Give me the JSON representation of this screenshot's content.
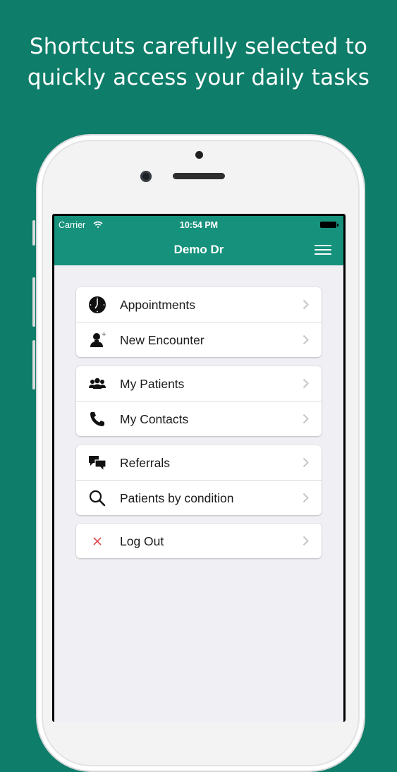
{
  "headline": {
    "line1": "Shortcuts carefully selected to",
    "line2": "quickly access your daily tasks"
  },
  "status_bar": {
    "carrier": "Carrier",
    "time": "10:54 PM"
  },
  "navbar": {
    "title": "Demo Dr",
    "menu_icon": "hamburger-icon"
  },
  "groups": [
    {
      "items": [
        {
          "label": "Appointments",
          "icon": "clock-icon"
        },
        {
          "label": "New Encounter",
          "icon": "person-add-icon"
        }
      ]
    },
    {
      "items": [
        {
          "label": "My Patients",
          "icon": "group-icon"
        },
        {
          "label": "My Contacts",
          "icon": "phone-icon"
        }
      ]
    },
    {
      "items": [
        {
          "label": "Referrals",
          "icon": "chat-bubbles-icon"
        },
        {
          "label": "Patients by condition",
          "icon": "search-icon"
        }
      ]
    },
    {
      "items": [
        {
          "label": "Log Out",
          "icon": "close-icon"
        }
      ]
    }
  ],
  "colors": {
    "background": "#0e7d69",
    "navbar": "#16917c",
    "logout_icon": "#e0484e"
  }
}
